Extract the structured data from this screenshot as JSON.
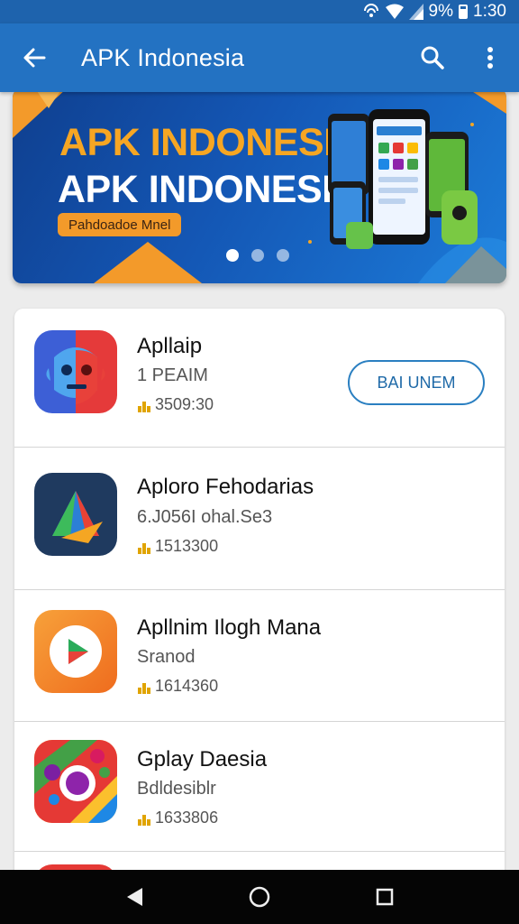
{
  "status_bar": {
    "battery": "9%",
    "time": "1:30",
    "icons": [
      "hotspot-icon",
      "wifi-icon",
      "signal-icon",
      "battery-icon"
    ]
  },
  "app_bar": {
    "title": "APK Indonesia",
    "icons": [
      "back-arrow-icon",
      "search-icon",
      "overflow-menu-icon"
    ]
  },
  "banner": {
    "line1": "APK INDONESIA",
    "line2": "APK INDONESIA",
    "pill": "Pahdoadoe Mnel",
    "dots": 3,
    "active_dot": 0,
    "colors": {
      "background": "#1457b5",
      "accent": "#f6a623"
    }
  },
  "apps": [
    {
      "name": "Apllaip",
      "subtitle": "1 PEAIM",
      "downloads": "3509:30",
      "icon": "app-icon-face",
      "action": "BAI UNEM"
    },
    {
      "name": "Aploro Fehodarias",
      "subtitle": "6.J056I ohal.Se3",
      "downloads": "1513300",
      "icon": "app-icon-arrow"
    },
    {
      "name": "Apllnim Ilogh Mana",
      "subtitle": "Sranod",
      "downloads": "1614360",
      "icon": "app-icon-play"
    },
    {
      "name": "Gplay Daesia",
      "subtitle": "Bdldesiblr",
      "downloads": "1633806",
      "icon": "app-icon-colorful"
    }
  ],
  "colors": {
    "primary": "#2372c2",
    "status_bar": "#1e63ad",
    "install_border": "#2a7fc1",
    "download_icon": "#e0a400"
  },
  "nav_bar": {
    "icons": [
      "back-triangle-icon",
      "home-circle-icon",
      "recents-square-icon"
    ]
  }
}
